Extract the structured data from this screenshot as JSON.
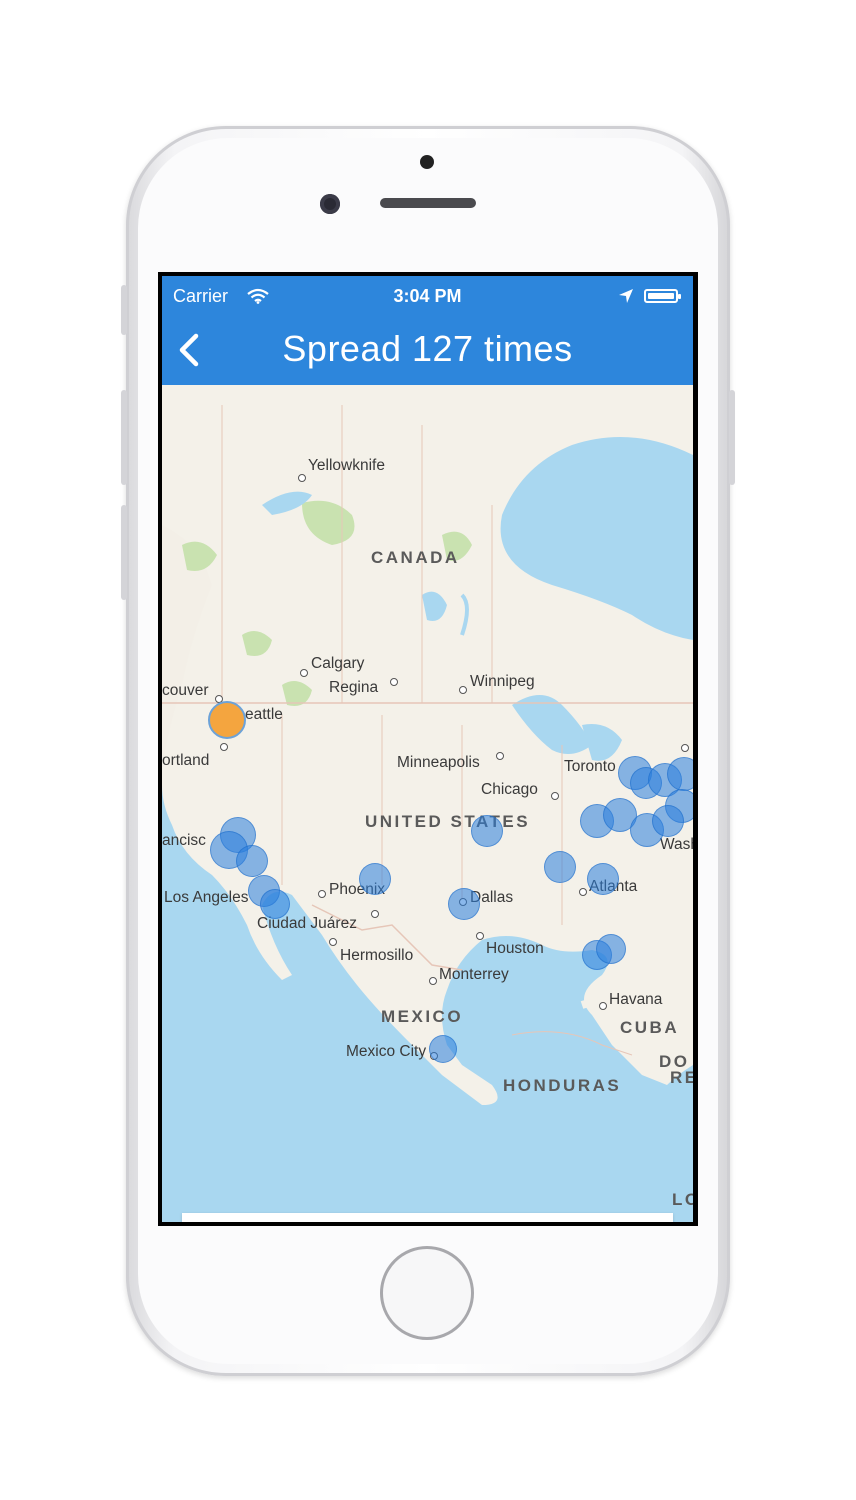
{
  "status_bar": {
    "carrier": "Carrier",
    "time": "3:04 PM"
  },
  "nav": {
    "title": "Spread 127 times"
  },
  "map": {
    "countries": [
      "CANADA",
      "UNITED STATES",
      "MEXICO",
      "CUBA",
      "HONDURAS",
      "DO",
      "RE",
      "LO"
    ],
    "cities": [
      "Yellowknife",
      "Calgary",
      "Regina",
      "Winnipeg",
      "couver",
      "eattle",
      "ortland",
      "Minneapolis",
      "Toronto",
      "Chicago",
      "ancisc",
      "Wash",
      "Phoenix",
      "Dallas",
      "Atlanta",
      "Los Angeles",
      "Ciudad Juárez",
      "Houston",
      "Hermosillo",
      "Monterrey",
      "Havana",
      "Mexico City"
    ],
    "origin_color": "#f4a53f",
    "spread_color": "#2a7edc"
  },
  "colors": {
    "accent": "#2d86dc",
    "water": "#a9d7f0",
    "land": "#f4f1e9",
    "park": "#c9e2b0"
  }
}
